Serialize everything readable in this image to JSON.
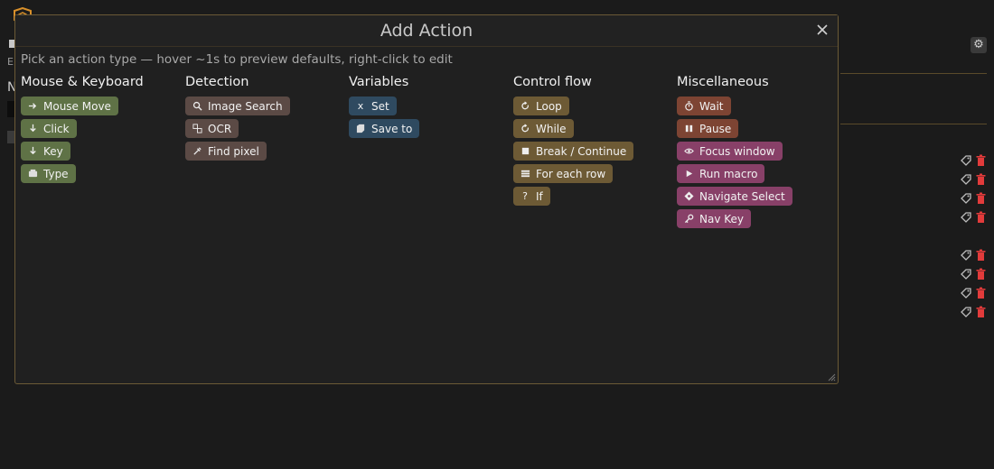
{
  "background": {
    "label_e": "E",
    "label_n": "N"
  },
  "dialog": {
    "title": "Add Action",
    "hint": "Pick an action type — hover ~1s to preview defaults, right-click to edit",
    "columns": [
      {
        "name": "Mouse & Keyboard",
        "color": "#5f7246",
        "items": [
          {
            "label": "Mouse Move",
            "icon": "arrow-right-icon"
          },
          {
            "label": "Click",
            "icon": "arrow-down-icon"
          },
          {
            "label": "Key",
            "icon": "arrow-down-icon"
          },
          {
            "label": "Type",
            "icon": "keyboard-icon"
          }
        ]
      },
      {
        "name": "Detection",
        "color": "#5b4a45",
        "items": [
          {
            "label": "Image Search",
            "icon": "search-icon"
          },
          {
            "label": "OCR",
            "icon": "ocr-icon"
          },
          {
            "label": "Find pixel",
            "icon": "eyedropper-icon"
          }
        ]
      },
      {
        "name": "Variables",
        "color": "#2f4a60",
        "items": [
          {
            "label": "Set",
            "icon": "x-icon"
          },
          {
            "label": "Save to",
            "icon": "save-icon"
          }
        ]
      },
      {
        "name": "Control flow",
        "color": "#6d5a35",
        "items": [
          {
            "label": "Loop",
            "icon": "loop-icon"
          },
          {
            "label": "While",
            "icon": "loop-icon"
          },
          {
            "label": "Break / Continue",
            "icon": "stop-icon"
          },
          {
            "label": "For each row",
            "icon": "rows-icon"
          },
          {
            "label": "If",
            "icon": "question-icon"
          }
        ]
      },
      {
        "name": "Miscellaneous",
        "color_wait": "#7d4433",
        "color_misc": "#884068",
        "items": [
          {
            "label": "Wait",
            "icon": "timer-icon",
            "color": "#7d4433"
          },
          {
            "label": "Pause",
            "icon": "pause-icon",
            "color": "#7d4433"
          },
          {
            "label": "Focus window",
            "icon": "eye-icon",
            "color": "#884068"
          },
          {
            "label": "Run macro",
            "icon": "play-icon",
            "color": "#884068"
          },
          {
            "label": "Navigate Select",
            "icon": "crosshair-icon",
            "color": "#884068"
          },
          {
            "label": "Nav Key",
            "icon": "key-icon",
            "color": "#884068"
          }
        ]
      }
    ]
  }
}
